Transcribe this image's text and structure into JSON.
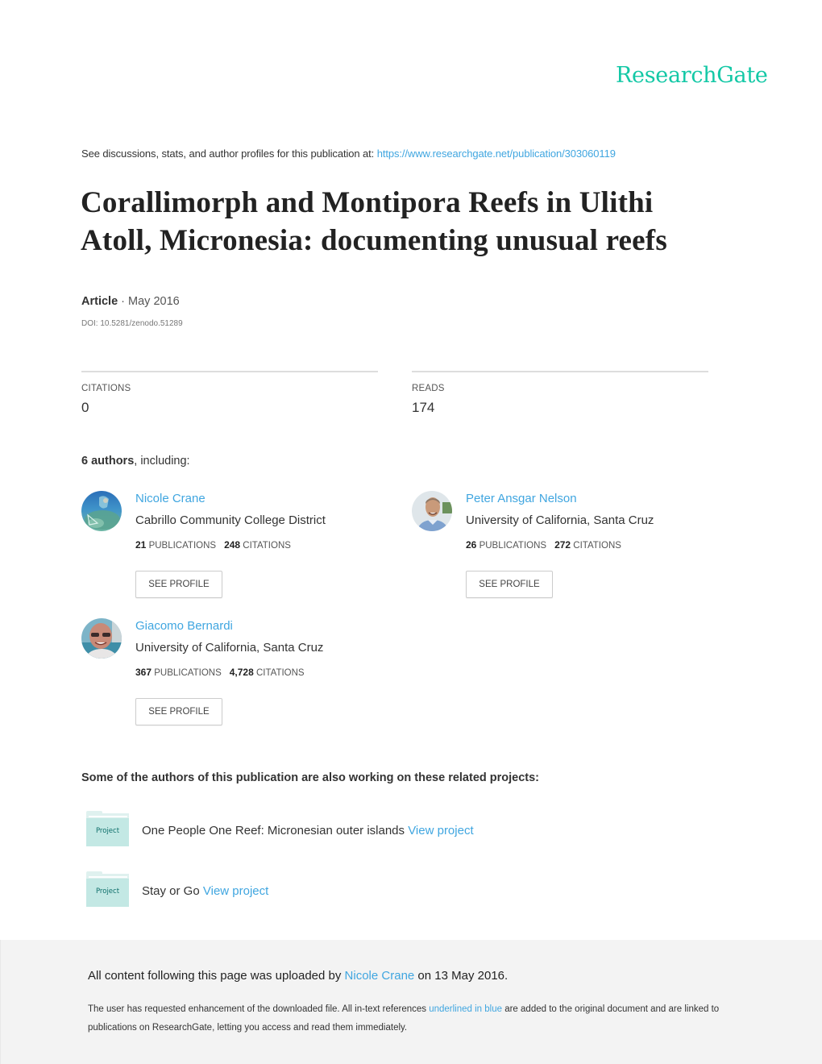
{
  "brand": {
    "name": "ResearchGate",
    "color": "#13c8a6"
  },
  "header": {
    "see_discussions_text": "See discussions, stats, and author profiles for this publication at: ",
    "publication_url": "https://www.researchgate.net/publication/303060119"
  },
  "publication": {
    "title": "Corallimorph and Montipora Reefs in Ulithi Atoll, Micronesia: documenting unusual reefs",
    "type": "Article",
    "separator": " · ",
    "date": "May 2016",
    "doi": "DOI: 10.5281/zenodo.51289"
  },
  "stats": {
    "citations_label": "CITATIONS",
    "citations_value": "0",
    "reads_label": "READS",
    "reads_value": "174"
  },
  "authors_heading": {
    "count_label": "6 authors",
    "suffix": ", including:"
  },
  "authors": [
    {
      "name": "Nicole Crane",
      "institution": "Cabrillo Community College District",
      "publications": "21",
      "publications_label": "PUBLICATIONS",
      "citations": "248",
      "citations_label": "CITATIONS",
      "button": "SEE PROFILE",
      "avatar": "underwater-diver-photo"
    },
    {
      "name": "Peter Ansgar Nelson",
      "institution": "University of California, Santa Cruz",
      "publications": "26",
      "publications_label": "PUBLICATIONS",
      "citations": "272",
      "citations_label": "CITATIONS",
      "button": "SEE PROFILE",
      "avatar": "portrait-photo"
    },
    {
      "name": "Giacomo Bernardi",
      "institution": "University of California, Santa Cruz",
      "publications": "367",
      "publications_label": "PUBLICATIONS",
      "citations": "4,728",
      "citations_label": "CITATIONS",
      "button": "SEE PROFILE",
      "avatar": "portrait-sunglasses-photo"
    }
  ],
  "projects_heading": "Some of the authors of this publication are also working on these related projects:",
  "projects": [
    {
      "icon_label": "Project",
      "title": "One People One Reef: Micronesian outer islands",
      "link": "View project"
    },
    {
      "icon_label": "Project",
      "title": "Stay or Go",
      "link": "View project"
    }
  ],
  "footer": {
    "uploaded_prefix": "All content following this page was uploaded by ",
    "uploader": "Nicole Crane",
    "uploaded_suffix": " on 13 May 2016.",
    "note_prefix": "The user has requested enhancement of the downloaded file. All in-text references ",
    "note_link": "underlined in blue",
    "note_suffix": " are added to the original document and are linked to publications on ResearchGate, letting you access and read them immediately."
  },
  "colors": {
    "link": "#40a6e0",
    "footer_bg": "#f3f3f3",
    "project_folder": "#c3e8e4"
  }
}
